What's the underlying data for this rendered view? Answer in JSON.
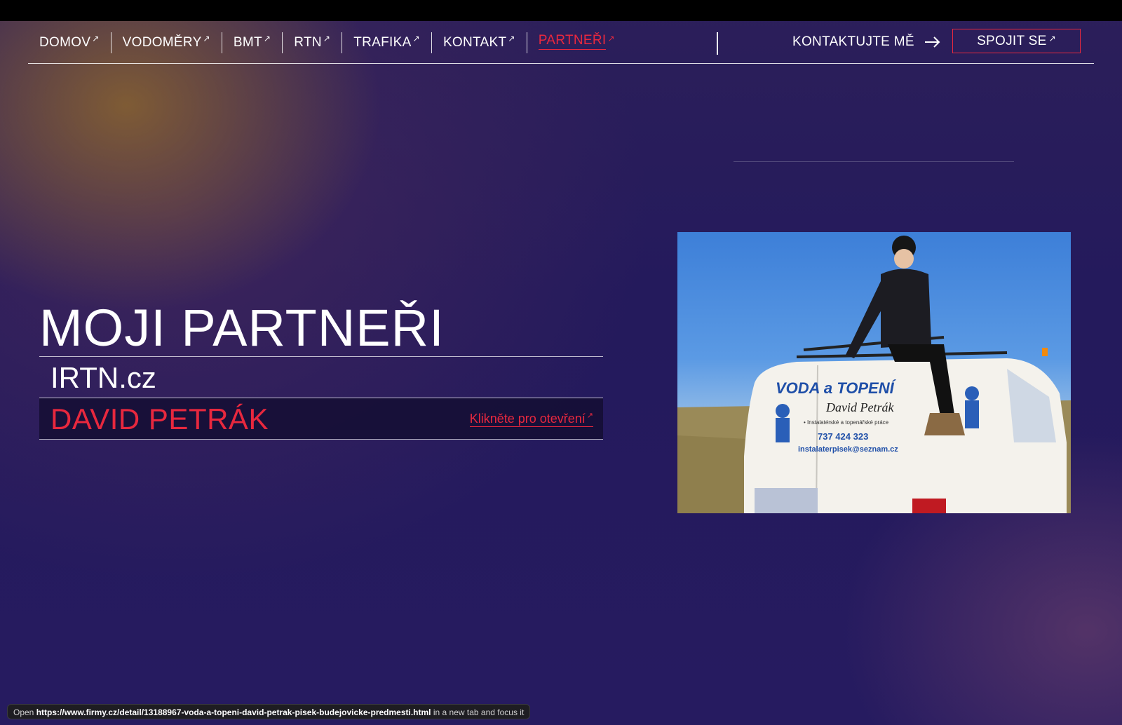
{
  "nav": {
    "items": [
      {
        "label": "DOMOV",
        "ext": "↗",
        "active": false
      },
      {
        "label": "VODOMĚRY",
        "ext": "↗",
        "active": false
      },
      {
        "label": "BMT",
        "ext": "↗",
        "active": false
      },
      {
        "label": "RTN",
        "ext": "↗",
        "active": false
      },
      {
        "label": "TRAFIKA",
        "ext": "↗",
        "active": false
      },
      {
        "label": "KONTAKT",
        "ext": "↗",
        "active": false
      },
      {
        "label": "PARTNEŘI",
        "ext": "↗",
        "active": true
      }
    ],
    "contact_label": "KONTAKTUJTE MĚ",
    "connect_label": "SPOJIT SE",
    "connect_ext": "↗"
  },
  "hero": {
    "title": "MOJI PARTNEŘI",
    "partners": [
      {
        "name": "IRTN.cz"
      },
      {
        "name": "DAVID PETRÁK",
        "link_label": "Klikněte pro otevření",
        "link_ext": "↗"
      }
    ]
  },
  "photo": {
    "van_text_line1": "VODA a TOPENÍ",
    "van_text_line2": "David Petrák",
    "van_text_line3": "• Instalatérské a topenářské práce",
    "van_phone": "737 424 323",
    "van_email": "instalaterpisek@seznam.cz"
  },
  "status": {
    "prefix": "Open",
    "url": "https://www.firmy.cz/detail/13188967-voda-a-topeni-david-petrak-pisek-budejovicke-predmesti.html",
    "suffix": "in a new tab and focus it"
  },
  "colors": {
    "accent": "#e8283e",
    "background": "#24195a"
  }
}
